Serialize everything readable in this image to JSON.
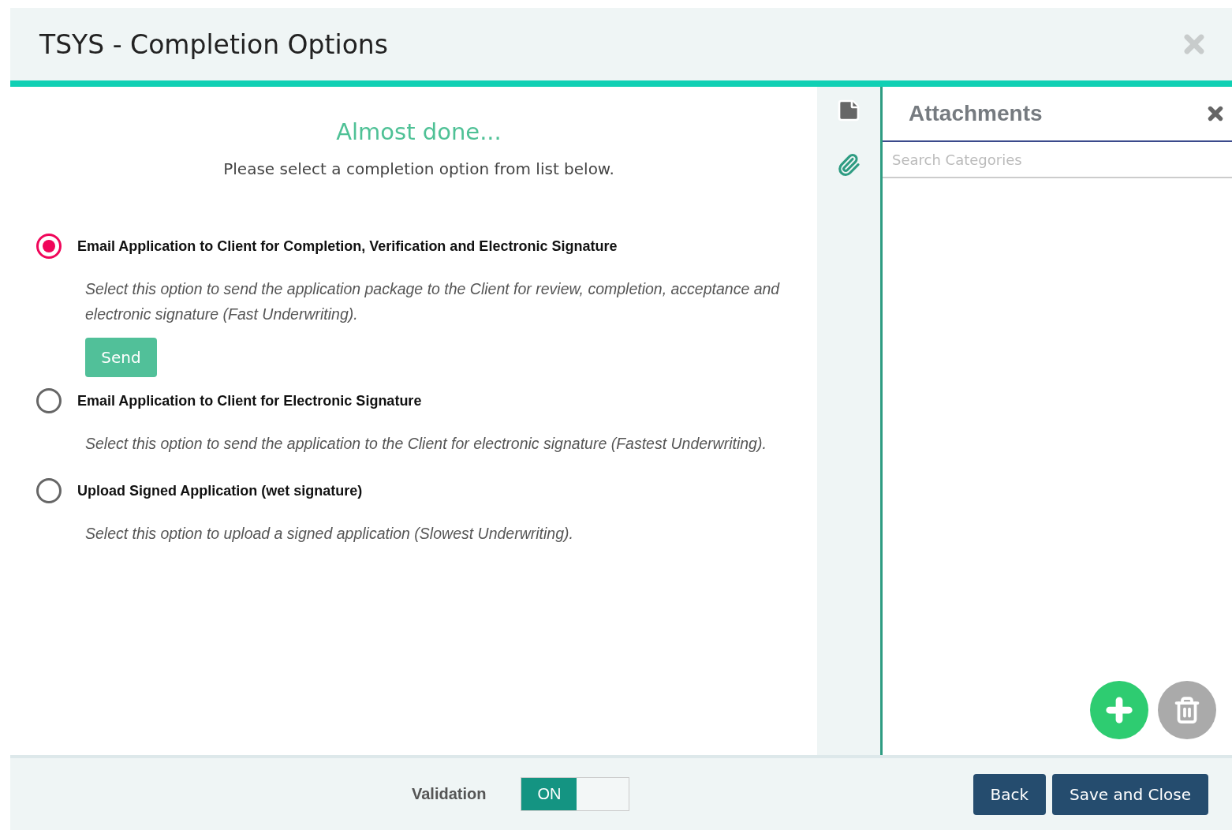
{
  "window": {
    "title": "TSYS - Completion Options"
  },
  "intro": {
    "heading": "Almost done...",
    "subheading": "Please select a completion option from list below."
  },
  "options": [
    {
      "label": "Email Application to Client for Completion, Verification and Electronic Signature",
      "description": "Select this option to send the application package to the Client for review, completion, acceptance and electronic signature (Fast Underwriting).",
      "selected": true,
      "action": "Send"
    },
    {
      "label": "Email Application to Client for Electronic Signature",
      "description": "Select this option to send the application to the Client for electronic signature (Fastest Underwriting).",
      "selected": false
    },
    {
      "label": "Upload Signed Application (wet signature)",
      "description": "Select this option to upload a signed application (Slowest Underwriting).",
      "selected": false
    }
  ],
  "side_tabs": [
    {
      "kind": "note",
      "selected": false
    },
    {
      "kind": "attachment",
      "selected": true
    }
  ],
  "attachments": {
    "title": "Attachments",
    "search": {
      "placeholder": "Search Categories"
    }
  },
  "footer": {
    "validation": {
      "label": "Validation",
      "on": true,
      "state_text": "ON"
    },
    "buttons": [
      "Back",
      "Save and Close"
    ]
  }
}
